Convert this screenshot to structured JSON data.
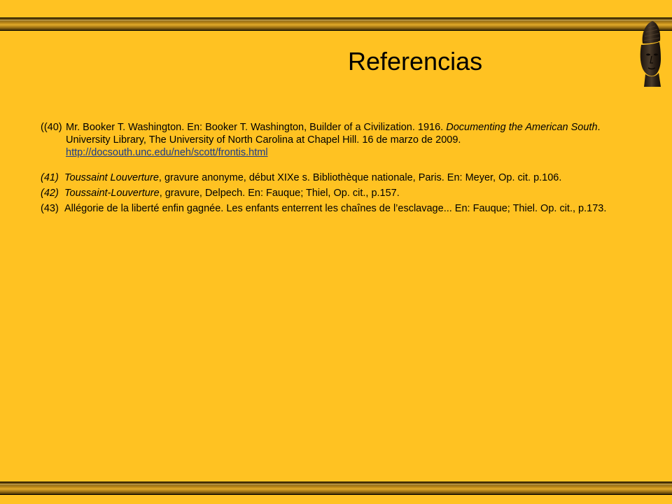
{
  "slide": {
    "title": "Referencias",
    "colors": {
      "background": "#FFC222",
      "bar": "#8a6310",
      "link": "#1a3a8a"
    },
    "decorations": {
      "top_bar": "gradient-bar",
      "bottom_bar": "gradient-bar",
      "image": "bronze-bust-icon"
    }
  },
  "references": [
    {
      "num": "((40)",
      "p1": "Mr. Booker T. Washington. En: Booker T. Washington, Builder of a Civilization. 1916. ",
      "p2_italic": "Documenting the American South",
      "p3": ". University Library, The University of North Carolina at Chapel Hill. 16 de marzo de 2009.",
      "link": "http://docsouth.unc.edu/neh/scott/frontis.html"
    },
    {
      "num": "(41)",
      "italic": "Toussaint Louverture",
      "rest": ", gravure anonyme, début XIXe s. Bibliothèque nationale, Paris. En: Meyer, Op. cit. p.106."
    },
    {
      "num": "(42)",
      "italic": "Toussaint-Louverture",
      "rest": ", gravure, Delpech. En: Fauque; Thiel, Op. cit., p.157."
    },
    {
      "num": "(43)",
      "text": "Allégorie de la liberté enfin gagnée. Les enfants enterrent les chaînes de l’esclavage... En: Fauque; Thiel. Op. cit.,  p.173."
    }
  ]
}
